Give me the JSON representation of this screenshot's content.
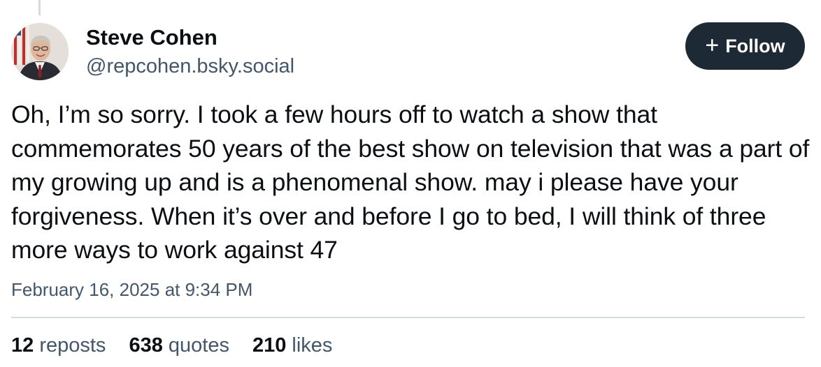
{
  "post": {
    "author": {
      "display_name": "Steve Cohen",
      "handle": "@repcohen.bsky.social"
    },
    "follow_button": {
      "icon": "plus-icon",
      "label": "Follow"
    },
    "text": "Oh, I’m so sorry. I took a few hours off to watch a show that commemorates 50 years of the best show on television that was a part of my growing up and is a phenomenal show. may i please have your forgiveness. When it’s over and before I go to bed, I will think of three more ways to work against 47",
    "timestamp": "February 16, 2025 at 9:34 PM",
    "stats": {
      "reposts_count": "12",
      "reposts_label": "reposts",
      "quotes_count": "638",
      "quotes_label": "quotes",
      "likes_count": "210",
      "likes_label": "likes"
    }
  },
  "colors": {
    "text_primary": "#0b0f14",
    "text_secondary": "#42576c",
    "button_background": "#1e2936",
    "divider": "#d4dbe2"
  }
}
